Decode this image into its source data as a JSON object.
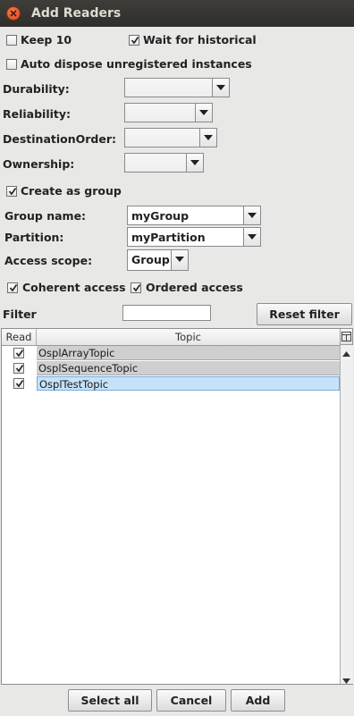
{
  "window": {
    "title": "Add Readers"
  },
  "options": {
    "keep10": {
      "label": "Keep 10",
      "checked": false
    },
    "wait_historical": {
      "label": "Wait for historical",
      "checked": true
    },
    "auto_dispose": {
      "label": "Auto dispose unregistered instances",
      "checked": false
    }
  },
  "qos": {
    "durability": {
      "label": "Durability:",
      "value": ""
    },
    "reliability": {
      "label": "Reliability:",
      "value": ""
    },
    "destination_order": {
      "label": "DestinationOrder:",
      "value": ""
    },
    "ownership": {
      "label": "Ownership:",
      "value": ""
    }
  },
  "group": {
    "create_as_group": {
      "label": "Create as group",
      "checked": true
    },
    "group_name": {
      "label": "Group name:",
      "value": "myGroup"
    },
    "partition": {
      "label": "Partition:",
      "value": "myPartition"
    },
    "access_scope": {
      "label": "Access scope:",
      "value": "Group"
    },
    "coherent": {
      "label": "Coherent access",
      "checked": true
    },
    "ordered": {
      "label": "Ordered access",
      "checked": true
    }
  },
  "filter": {
    "label": "Filter",
    "value": "",
    "reset_label": "Reset filter"
  },
  "table": {
    "columns": [
      "Read",
      "Topic"
    ],
    "rows": [
      {
        "read": true,
        "topic": "OsplArrayTopic",
        "selected": false
      },
      {
        "read": true,
        "topic": "OsplSequenceTopic",
        "selected": false
      },
      {
        "read": true,
        "topic": "OsplTestTopic",
        "selected": true
      }
    ]
  },
  "buttons": {
    "select_all": "Select all",
    "cancel": "Cancel",
    "add": "Add"
  },
  "colors": {
    "selected_row": "#c5e3fb",
    "row_bg": "#cfcfcf",
    "titlebar": "#3c3b37",
    "close": "#e5562a"
  }
}
